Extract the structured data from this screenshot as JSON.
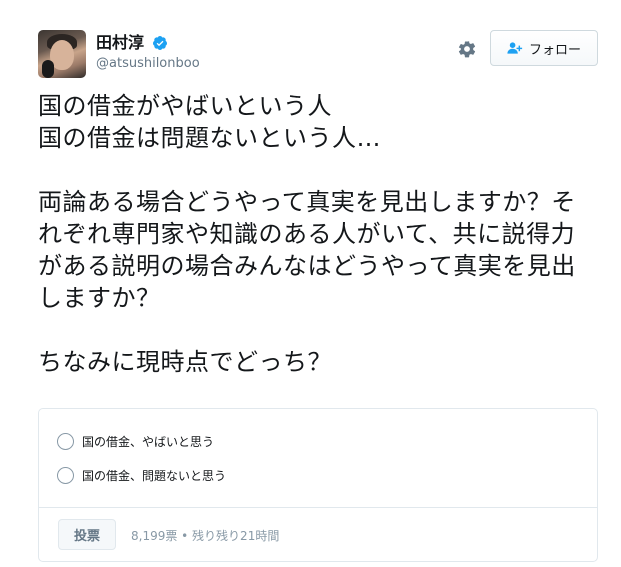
{
  "user": {
    "display_name": "田村淳",
    "handle": "@atsushilonboo",
    "verified": true
  },
  "header": {
    "follow_label": "フォロー",
    "icons": [
      "gear-icon",
      "follow-person-icon",
      "verified-badge-icon"
    ]
  },
  "tweet": {
    "text": "国の借金がやばいという人\n国の借金は問題ないという人…\n\n両論ある場合どうやって真実を見出しますか？それぞれ専門家や知識のある人がいて、共に説得力がある説明の場合みんなはどうやって真実を見出しますか？\n\nちなみに現時点でどっち？"
  },
  "poll": {
    "options": [
      {
        "label": "国の借金、やばいと思う"
      },
      {
        "label": "国の借金、問題ないと思う"
      }
    ],
    "vote_label": "投票",
    "meta": "8,199票 • 残り残り21時間"
  },
  "colors": {
    "text": "#14171a",
    "secondary": "#657786",
    "verified": "#1da1f2",
    "border": "#e1e8ed"
  }
}
